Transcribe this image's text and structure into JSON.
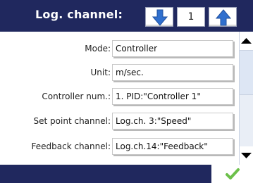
{
  "header": {
    "title": "Log. channel:",
    "counter_value": "1",
    "down_icon": "arrow-down-icon",
    "up_icon": "arrow-up-icon",
    "arrow_color": "#2f6fce",
    "background": "#20285e"
  },
  "rows": [
    {
      "label": "Mode:",
      "value": "Controller"
    },
    {
      "label": "Unit:",
      "value": "m/sec."
    },
    {
      "label": "Controller num.:",
      "value": "1. PID:\"Controller 1\""
    },
    {
      "label": "Set point channel:",
      "value": "Log.ch. 3:\"Speed\""
    },
    {
      "label": "Feedback channel:",
      "value": "Log.ch.14:\"Feedback\""
    }
  ],
  "scrollbar": {
    "up_icon": "triangle-up-icon",
    "down_icon": "triangle-down-icon"
  },
  "footer": {
    "confirm_icon": "checkmark-icon",
    "check_color": "#6cc04a"
  }
}
